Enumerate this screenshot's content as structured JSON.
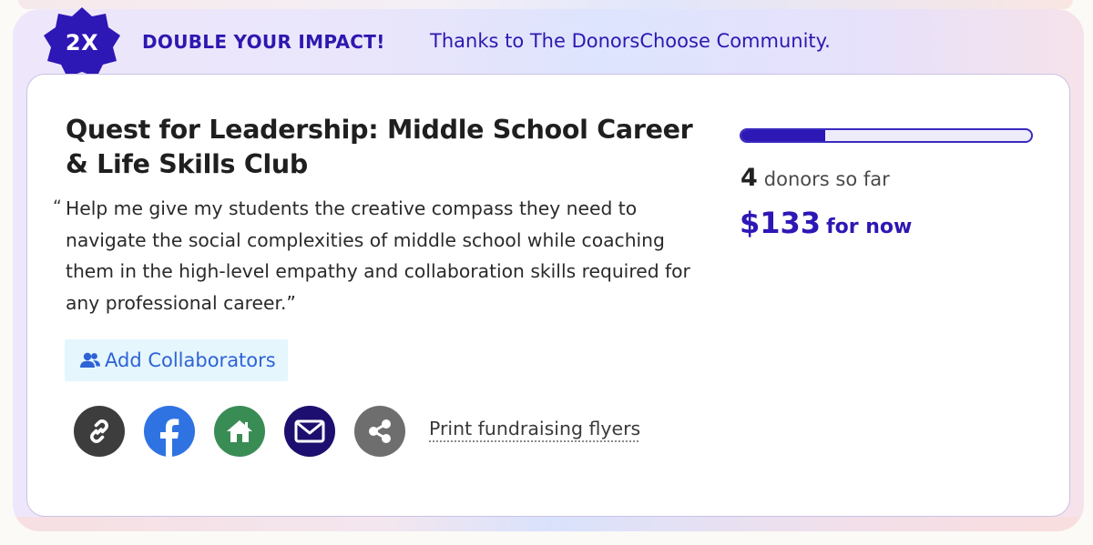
{
  "colors": {
    "brand_purple": "#2d17b5",
    "link_blue": "#2e63d6",
    "collab_bg": "#e5f6fd",
    "copy_link_bg": "#3d3d3d",
    "facebook_bg": "#2f73e2",
    "website_bg": "#3a8c55",
    "email_bg": "#1d0f6f",
    "share_bg": "#6e6e6e"
  },
  "banner": {
    "badge": "2X",
    "title": "DOUBLE YOUR IMPACT!",
    "subtitle": "Thanks to The DonorsChoose Community."
  },
  "project": {
    "title": "Quest for Leadership: Middle School Career & Life Skills Club",
    "quote_mark": "“",
    "quote": "Help me give my students the creative compass they need to navigate the social complexities of middle school while coaching them in the high-level empathy and collaboration skills required for any professional career.”"
  },
  "actions": {
    "add_collaborators": "Add Collaborators",
    "print_flyers": "Print fundraising flyers",
    "share_icons": [
      "link-icon",
      "facebook-icon",
      "website-icon",
      "email-icon",
      "share-icon"
    ]
  },
  "stats": {
    "progress_fraction": 0.29,
    "donor_count": "4",
    "donors_label": "donors so far",
    "amount": "$133",
    "amount_label": "for now"
  }
}
